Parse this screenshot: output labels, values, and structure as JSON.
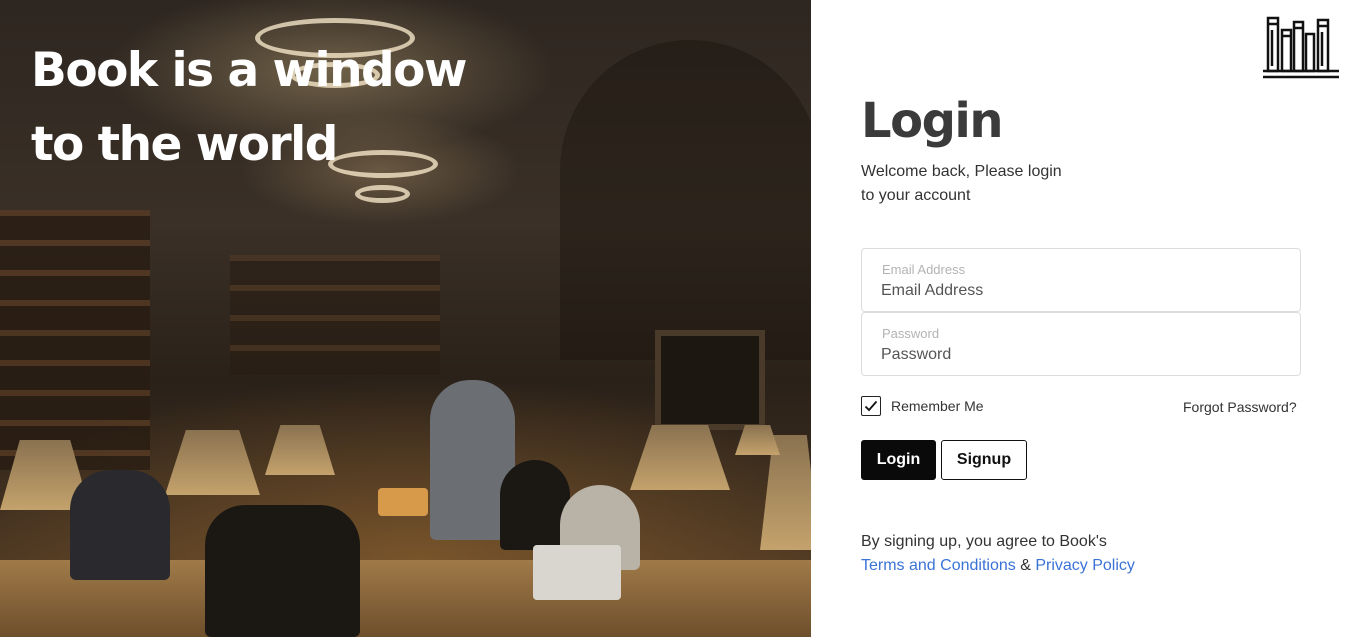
{
  "hero": {
    "title_line1": "Book is a window",
    "title_line2": "to the world"
  },
  "logo": {
    "icon": "bookshelf-icon"
  },
  "login": {
    "title": "Login",
    "welcome_line1": "Welcome back, Please login",
    "welcome_line2": "to your account",
    "email": {
      "label": "Email Address",
      "placeholder": "Email Address",
      "value": ""
    },
    "password": {
      "label": "Password",
      "placeholder": "Password",
      "value": ""
    },
    "remember_label": "Remember Me",
    "remember_checked": true,
    "forgot_label": "Forgot Password?",
    "login_button": "Login",
    "signup_button": "Signup",
    "terms_prefix": "By signing up, you agree to Book's",
    "terms_link": "Terms and Conditions",
    "terms_and": "&",
    "privacy_link": "Privacy Policy",
    "link_color": "#3a73d6"
  }
}
